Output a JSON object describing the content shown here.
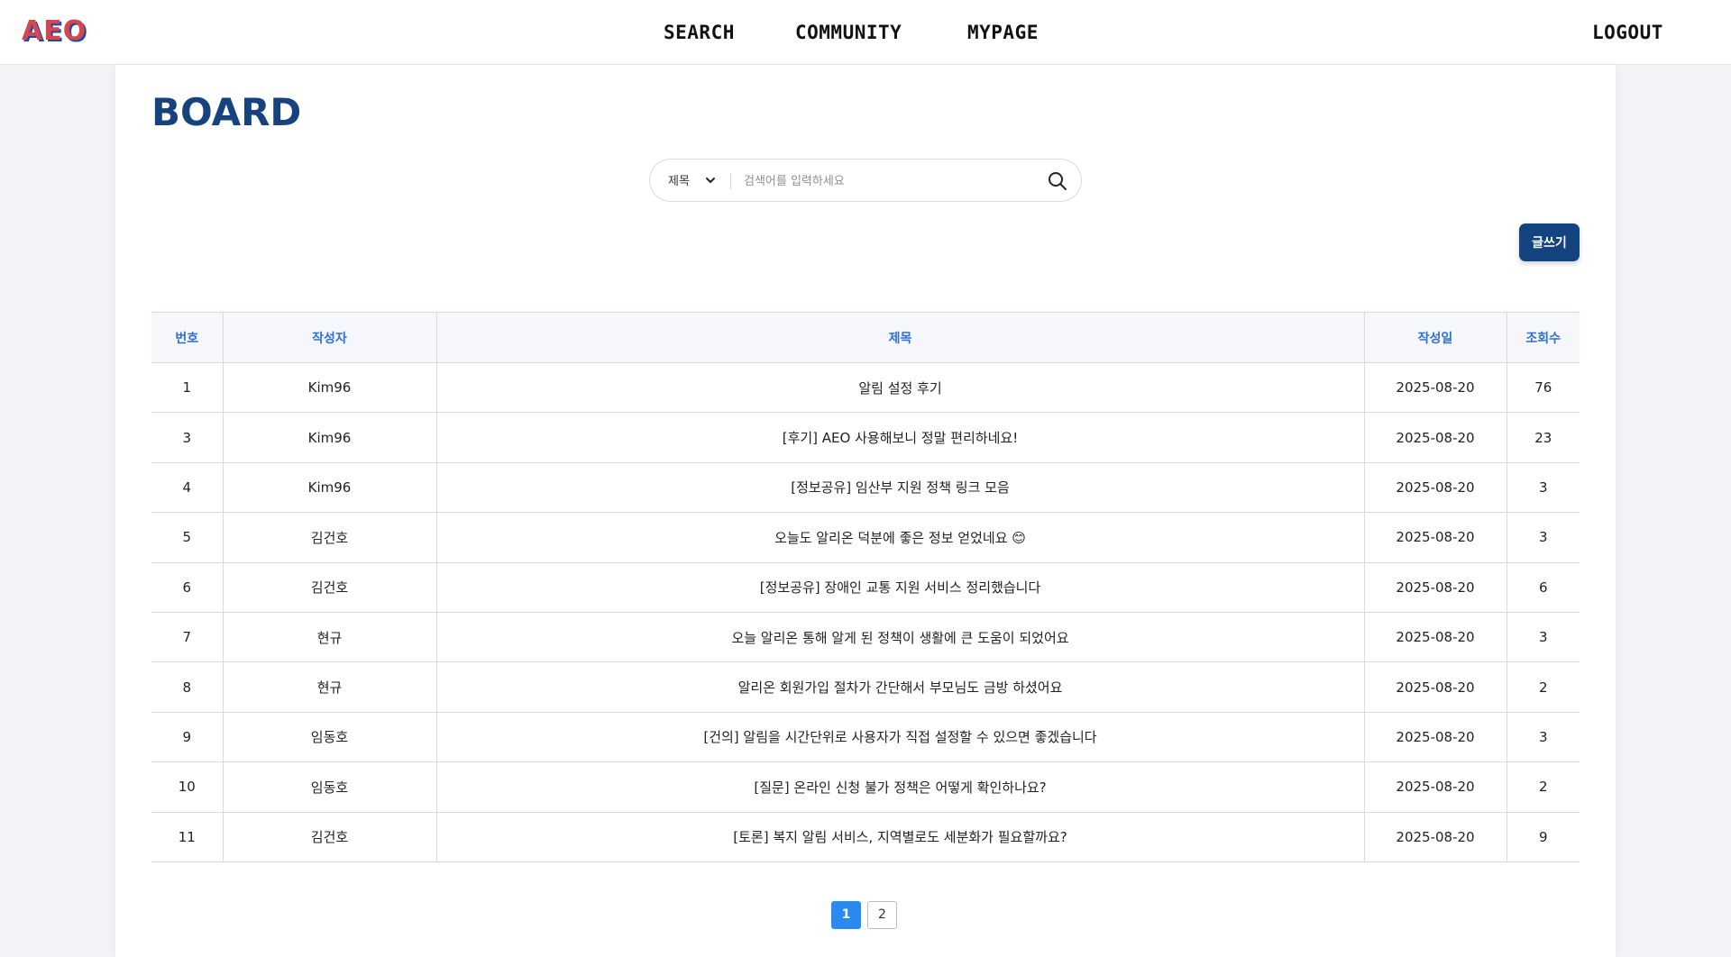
{
  "header": {
    "logo": "AEO",
    "nav": [
      "SEARCH",
      "COMMUNITY",
      "MYPAGE"
    ],
    "logout": "LOGOUT"
  },
  "page": {
    "title": "BOARD"
  },
  "search": {
    "select_value": "제목",
    "placeholder": "검색어를 입력하세요",
    "icon": "search-icon"
  },
  "write_button": "글쓰기",
  "table": {
    "headers": [
      "번호",
      "작성자",
      "제목",
      "작성일",
      "조회수"
    ],
    "rows": [
      {
        "no": "1",
        "author": "Kim96",
        "title": "알림 설정 후기",
        "date": "2025-08-20",
        "views": "76"
      },
      {
        "no": "3",
        "author": "Kim96",
        "title": "[후기] AEO 사용해보니 정말 편리하네요!",
        "date": "2025-08-20",
        "views": "23"
      },
      {
        "no": "4",
        "author": "Kim96",
        "title": "[정보공유] 임산부 지원 정책 링크 모음",
        "date": "2025-08-20",
        "views": "3"
      },
      {
        "no": "5",
        "author": "김건호",
        "title": "오늘도 알리온 덕분에 좋은 정보 얻었네요 😊",
        "date": "2025-08-20",
        "views": "3"
      },
      {
        "no": "6",
        "author": "김건호",
        "title": "[정보공유] 장애인 교통 지원 서비스 정리했습니다",
        "date": "2025-08-20",
        "views": "6"
      },
      {
        "no": "7",
        "author": "현규",
        "title": "오늘 알리온 통해 알게 된 정책이 생활에 큰 도움이 되었어요",
        "date": "2025-08-20",
        "views": "3"
      },
      {
        "no": "8",
        "author": "현규",
        "title": "알리온 회원가입 절차가 간단해서 부모님도 금방 하셨어요",
        "date": "2025-08-20",
        "views": "2"
      },
      {
        "no": "9",
        "author": "임동호",
        "title": "[건의] 알림을 시간단위로 사용자가 직접 설정할 수 있으면 좋겠습니다",
        "date": "2025-08-20",
        "views": "3"
      },
      {
        "no": "10",
        "author": "임동호",
        "title": "[질문] 온라인 신청 불가 정책은 어떻게 확인하나요?",
        "date": "2025-08-20",
        "views": "2"
      },
      {
        "no": "11",
        "author": "김건호",
        "title": "[토론] 복지 알림 서비스, 지역별로도 세분화가 필요할까요?",
        "date": "2025-08-20",
        "views": "9"
      }
    ]
  },
  "pagination": {
    "pages": [
      "1",
      "2"
    ],
    "current": "1"
  },
  "colors": {
    "brand_blue": "#14447f",
    "header_text_blue": "#2f6fd6",
    "page_active": "#2b8af0",
    "logo_red": "#d5464f"
  }
}
